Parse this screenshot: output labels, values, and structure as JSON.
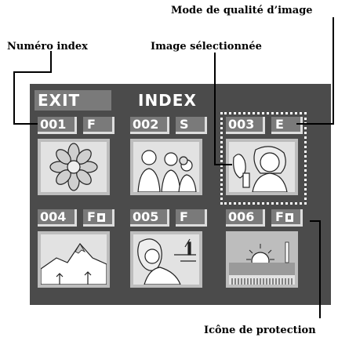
{
  "labels": {
    "mode": "Mode de qualité d’image",
    "index_number": "Numéro index",
    "selected": "Image sélectionnée",
    "protection": "Icône de protection"
  },
  "screen": {
    "exit": "EXIT",
    "title": "INDEX",
    "cells": [
      {
        "number": "001",
        "mode": "F",
        "protected": false,
        "image": "flower-icon"
      },
      {
        "number": "002",
        "mode": "S",
        "protected": false,
        "image": "family-icon"
      },
      {
        "number": "003",
        "mode": "E",
        "protected": false,
        "image": "girl-icon",
        "selected": true
      },
      {
        "number": "004",
        "mode": "F",
        "protected": true,
        "image": "mountain-icon"
      },
      {
        "number": "005",
        "mode": "F",
        "protected": false,
        "image": "woman-icon"
      },
      {
        "number": "006",
        "mode": "F",
        "protected": true,
        "image": "sunset-icon"
      }
    ]
  },
  "colors": {
    "screen_bg": "#4b4b4b",
    "label_bg": "#7a7a7a",
    "thumb_bg": "#e2e2e2"
  }
}
